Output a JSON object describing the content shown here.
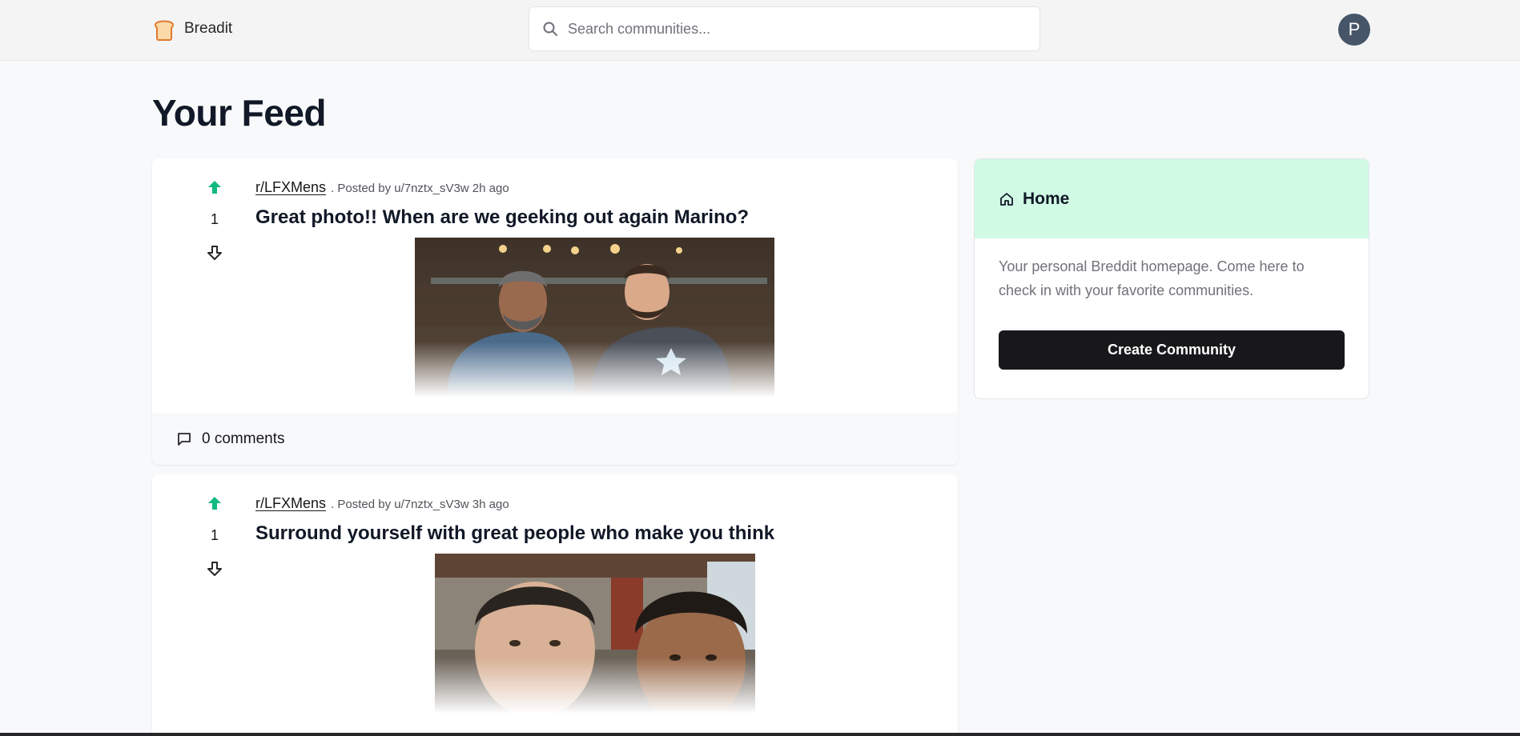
{
  "header": {
    "brand": "Breadit",
    "search_placeholder": "Search communities...",
    "avatar_initial": "P"
  },
  "feed": {
    "title": "Your Feed",
    "posts": [
      {
        "votes": "1",
        "subreddit": "r/LFXMens",
        "posted_by": ". Posted by u/7nztx_sV3w 2h ago",
        "title": "Great photo!! When are we geeking out again Marino?",
        "comments": "0 comments"
      },
      {
        "votes": "1",
        "subreddit": "r/LFXMens",
        "posted_by": ". Posted by u/7nztx_sV3w 3h ago",
        "title": "Surround yourself with great people who make you think"
      }
    ]
  },
  "sidebar": {
    "title": "Home",
    "description": "Your personal Breddit homepage. Come here to check in with your favorite communities.",
    "button": "Create Community"
  },
  "colors": {
    "upvote": "#10b981",
    "sidebar_header_bg": "#d1fae5",
    "primary_button": "#18181b",
    "avatar_bg": "#475569"
  },
  "icons": [
    "bread-logo-icon",
    "search-icon",
    "arrow-up-icon",
    "arrow-down-icon",
    "comment-icon",
    "home-icon"
  ]
}
